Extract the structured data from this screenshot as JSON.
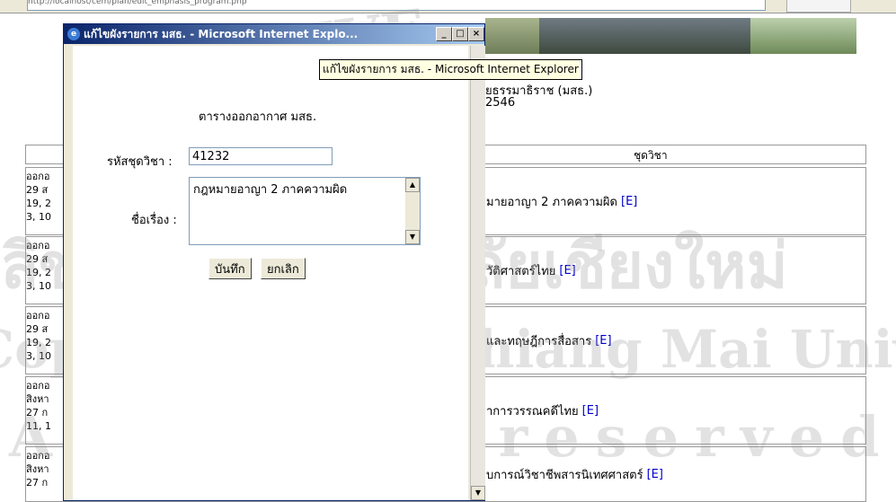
{
  "browser": {
    "address_text": "http://localhost/cem/plan/edit_emphasis_program.php",
    "go_label": ""
  },
  "page": {
    "header_line1": "ยธรรมาธิราช (มสธ.)",
    "header_line2": "2546",
    "table_header": "ชุดวิชา",
    "rows": [
      {
        "left": "ออกอ\n29 ส\n19, 2\n3, 10",
        "subject": "มายอาญา 2 ภาคความผิด",
        "link": "[E]"
      },
      {
        "left": "ออกอ\n29 ส\n19, 2\n3, 10",
        "subject": "วัติศาสตร์ไทย",
        "link": "[E]"
      },
      {
        "left": "ออกอ\n29 ส\n19, 2\n3, 10",
        "subject": "และทฤษฎีการสื่อสาร",
        "link": "[E]"
      },
      {
        "left": "ออกอ\nสิงหา\n27 ก\n11, 1",
        "subject": "าการวรรณคดีไทย",
        "link": "[E]"
      },
      {
        "left": "ออกอ\nสิงหา\n27 ก",
        "subject": "บการณ์วิชาชีพสารนิเทศศาสตร์",
        "link": "[E]"
      }
    ]
  },
  "popup": {
    "window_title": "แก้ไขผังรายการ มสธ. - Microsoft Internet Explo...",
    "tooltip": "แก้ไขผังรายการ มสธ. - Microsoft Internet Explorer",
    "heading": "ตารางออกอากาศ มสธ.",
    "code_label": "รหัสชุดวิชา :",
    "code_value": "41232",
    "title_label": "ชื่อเรื่อง :",
    "title_value": "กฎหมายอาญา 2 ภาคความผิด",
    "save_label": "บันทึก",
    "cancel_label": "ยกเลิก",
    "minimize_label": "_",
    "maximize_label": "□",
    "close_label": "×"
  },
  "watermark": {
    "line1": "AI UNIVE",
    "line2": "ลิขสิทธิ์มหาวิทยาลัยเชียงใหม่",
    "line3": "Copyright © by Chiang Mai University",
    "line4": "All rights reserved"
  }
}
